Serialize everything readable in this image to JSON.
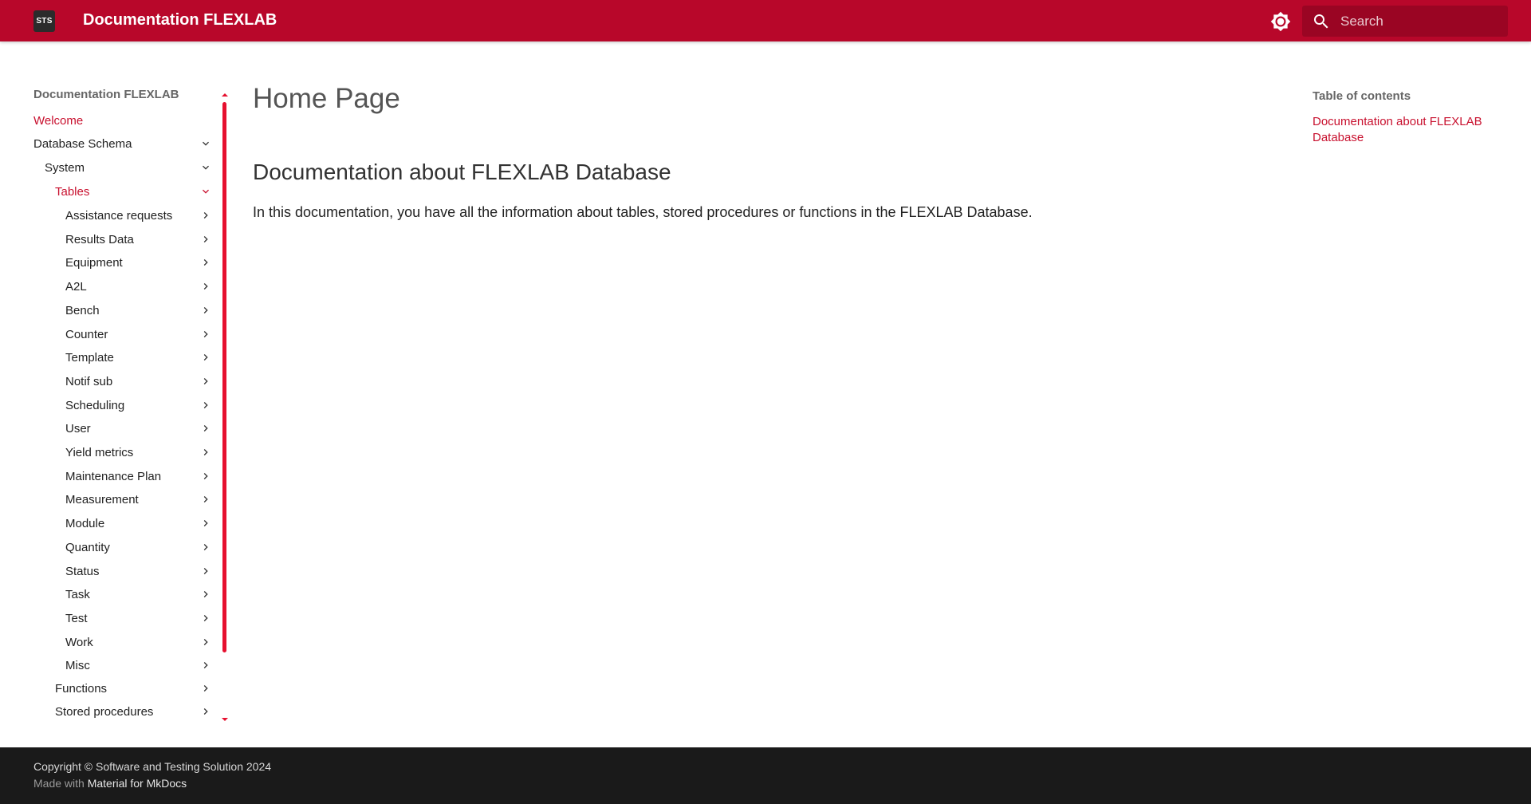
{
  "header": {
    "logo_text": "STS",
    "site_title": "Documentation FLEXLAB",
    "search_placeholder": "Search",
    "accent_color": "#b8072a",
    "theme_icon": "brightness-icon",
    "search_icon": "search-icon"
  },
  "sidebar": {
    "section_title": "Documentation FLEXLAB",
    "welcome": "Welcome",
    "database_schema": "Database Schema",
    "system": "System",
    "tables": "Tables",
    "table_items": [
      "Assistance requests",
      "Results Data",
      "Equipment",
      "A2L",
      "Bench",
      "Counter",
      "Template",
      "Notif sub",
      "Scheduling",
      "User",
      "Yield metrics",
      "Maintenance Plan",
      "Measurement",
      "Module",
      "Quantity",
      "Status",
      "Task",
      "Test",
      "Work",
      "Misc"
    ],
    "functions": "Functions",
    "stored_procedures": "Stored procedures"
  },
  "main": {
    "page_title": "Home Page",
    "section_heading": "Documentation about FLEXLAB Database",
    "paragraph": "In this documentation, you have all the information about tables, stored procedures or functions in the FLEXLAB Database."
  },
  "toc": {
    "title": "Table of contents",
    "links": [
      "Documentation about FLEXLAB Database"
    ]
  },
  "footer": {
    "copyright": "Copyright © Software and Testing Solution 2024",
    "made_with_prefix": "Made with",
    "made_with_link": "Material for MkDocs"
  }
}
